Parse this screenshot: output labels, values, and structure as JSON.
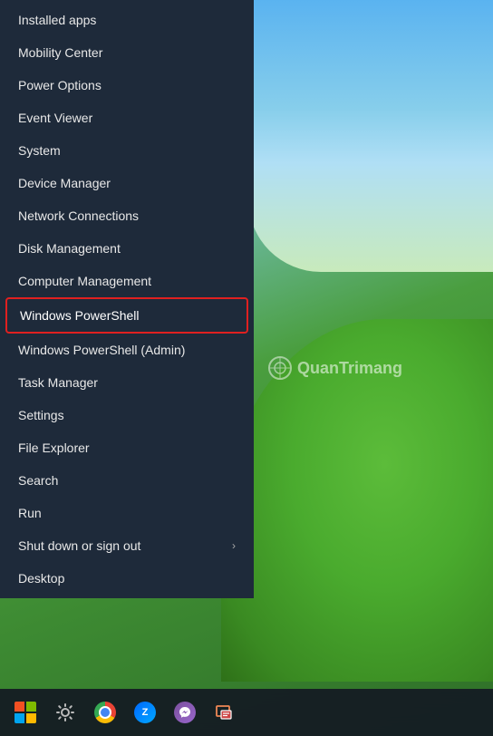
{
  "desktop": {
    "watermark": "QuanTrimang"
  },
  "contextMenu": {
    "items": [
      {
        "id": "installed-apps",
        "label": "Installed apps",
        "hasArrow": false,
        "highlighted": false
      },
      {
        "id": "mobility-center",
        "label": "Mobility Center",
        "hasArrow": false,
        "highlighted": false
      },
      {
        "id": "power-options",
        "label": "Power Options",
        "hasArrow": false,
        "highlighted": false
      },
      {
        "id": "event-viewer",
        "label": "Event Viewer",
        "hasArrow": false,
        "highlighted": false
      },
      {
        "id": "system",
        "label": "System",
        "hasArrow": false,
        "highlighted": false
      },
      {
        "id": "device-manager",
        "label": "Device Manager",
        "hasArrow": false,
        "highlighted": false
      },
      {
        "id": "network-connections",
        "label": "Network Connections",
        "hasArrow": false,
        "highlighted": false
      },
      {
        "id": "disk-management",
        "label": "Disk Management",
        "hasArrow": false,
        "highlighted": false
      },
      {
        "id": "computer-management",
        "label": "Computer Management",
        "hasArrow": false,
        "highlighted": false
      },
      {
        "id": "windows-powershell",
        "label": "Windows PowerShell",
        "hasArrow": false,
        "highlighted": true
      },
      {
        "id": "windows-powershell-admin",
        "label": "Windows PowerShell (Admin)",
        "hasArrow": false,
        "highlighted": false
      },
      {
        "id": "task-manager",
        "label": "Task Manager",
        "hasArrow": false,
        "highlighted": false
      },
      {
        "id": "settings",
        "label": "Settings",
        "hasArrow": false,
        "highlighted": false
      },
      {
        "id": "file-explorer",
        "label": "File Explorer",
        "hasArrow": false,
        "highlighted": false
      },
      {
        "id": "search",
        "label": "Search",
        "hasArrow": false,
        "highlighted": false
      },
      {
        "id": "run",
        "label": "Run",
        "hasArrow": false,
        "highlighted": false
      },
      {
        "id": "shut-down",
        "label": "Shut down or sign out",
        "hasArrow": true,
        "highlighted": false
      },
      {
        "id": "desktop",
        "label": "Desktop",
        "hasArrow": false,
        "highlighted": false
      }
    ]
  },
  "taskbar": {
    "icons": [
      {
        "id": "start",
        "type": "start",
        "label": "Start"
      },
      {
        "id": "settings",
        "type": "gear",
        "label": "Settings"
      },
      {
        "id": "chrome",
        "type": "chrome",
        "label": "Google Chrome"
      },
      {
        "id": "zalo",
        "type": "zalo",
        "label": "Zalo"
      },
      {
        "id": "viber",
        "type": "viber",
        "label": "Viber"
      },
      {
        "id": "snip",
        "type": "snip",
        "label": "Snip & Sketch"
      }
    ]
  }
}
